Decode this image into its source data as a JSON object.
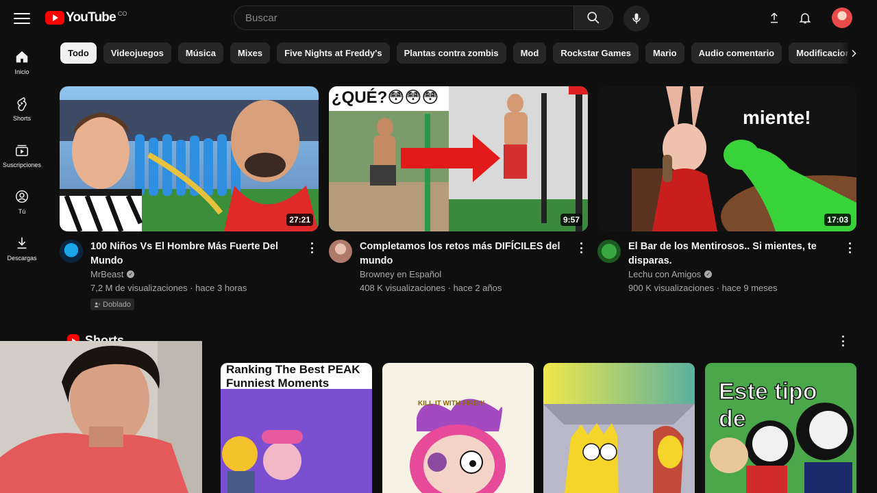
{
  "header": {
    "logo_text": "YouTube",
    "country_code": "CO",
    "search_placeholder": "Buscar"
  },
  "guide": [
    {
      "label": "Inicio",
      "icon": "home-icon"
    },
    {
      "label": "Shorts",
      "icon": "shorts-icon"
    },
    {
      "label": "Suscripciones",
      "icon": "subscriptions-icon"
    },
    {
      "label": "Tú",
      "icon": "you-icon"
    },
    {
      "label": "Descargas",
      "icon": "downloads-icon"
    }
  ],
  "chips": [
    "Todo",
    "Videojuegos",
    "Música",
    "Mixes",
    "Five Nights at Freddy's",
    "Plantas contra zombis",
    "Mod",
    "Rockstar Games",
    "Mario",
    "Audio comentario",
    "Modificaciones de"
  ],
  "videos": [
    {
      "title": "100 Niños Vs El Hombre Más Fuerte Del Mundo",
      "channel": "MrBeast",
      "verified": true,
      "stats": "7,2 M de visualizaciones · hace 3 horas",
      "duration": "27:21",
      "badge": "Doblado"
    },
    {
      "title": "Completamos los retos más DIFÍCILES del mundo",
      "channel": "Browney en Español",
      "verified": false,
      "stats": "408 K visualizaciones · hace 2 años",
      "duration": "9:57",
      "thumb_text": "¿QUÉ?😳😳😳"
    },
    {
      "title": "El Bar de los Mentirosos.. Si mientes, te disparas.",
      "channel": "Lechu con Amigos",
      "verified": true,
      "stats": "900 K visualizaciones · hace 9 meses",
      "duration": "17:03",
      "thumb_text": "miente!"
    }
  ],
  "shorts": {
    "title": "Shorts",
    "items": [
      {
        "thumb_text": "Ranking The Best PEAK Funniest Moments"
      },
      {
        "thumb_text": "KILL IT WITH FIRE!!!"
      },
      {
        "thumb_text": ""
      },
      {
        "thumb_text": "Este tipo de"
      }
    ]
  },
  "colors": {
    "background": "#0f0f0f",
    "brand_red": "#ff0000",
    "chip_bg": "#272727",
    "text_secondary": "#aaaaaa"
  }
}
